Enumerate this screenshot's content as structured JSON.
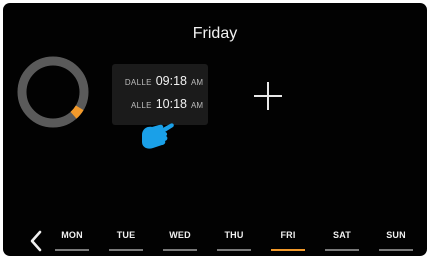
{
  "header": {
    "day": "Friday"
  },
  "timer_ring": {
    "track_color": "#5a5a5a",
    "accent_color": "#f39a2b",
    "marker_fraction": 0.36
  },
  "schedule": {
    "from_label": "DALLE",
    "from_time": "09:18",
    "from_ampm": "AM",
    "to_label": "ALLE",
    "to_time": "10:18",
    "to_ampm": "AM"
  },
  "hint": {
    "icon": "pointing-hand-icon",
    "color": "#1aa0e8"
  },
  "add_button": {
    "icon": "plus-icon"
  },
  "nav": {
    "back_icon": "chevron-left-icon",
    "days": [
      {
        "label": "MON",
        "active": false
      },
      {
        "label": "TUE",
        "active": false
      },
      {
        "label": "WED",
        "active": false
      },
      {
        "label": "THU",
        "active": false
      },
      {
        "label": "FRI",
        "active": true
      },
      {
        "label": "SAT",
        "active": false
      },
      {
        "label": "SUN",
        "active": false
      }
    ]
  }
}
